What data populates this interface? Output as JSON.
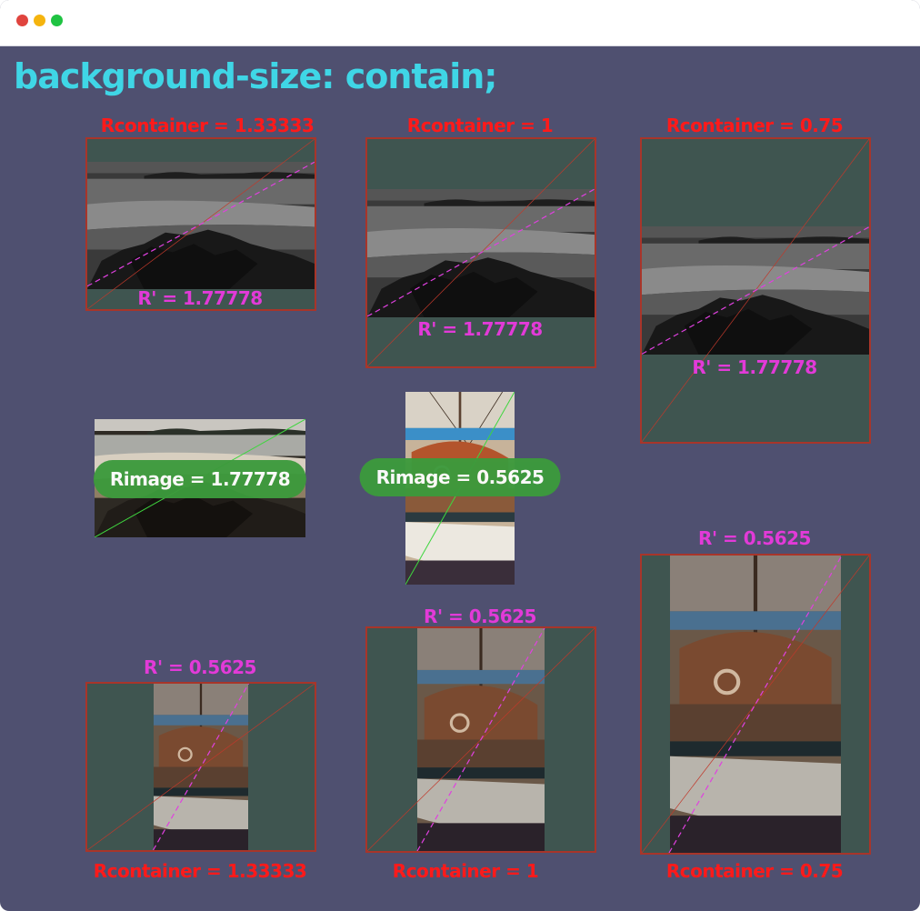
{
  "window": {
    "controls": [
      "close",
      "minimize",
      "maximize"
    ],
    "title": "background-size: contain;"
  },
  "labels": {
    "rcontainer_133": "Rcontainer = 1.33333",
    "rcontainer_1": "Rcontainer = 1",
    "rcontainer_075": "Rcontainer = 0.75",
    "r_prime_wide": "R' = 1.77778",
    "r_prime_tall": "R' = 0.5625",
    "rimage_wide": "Rimage = 1.77778",
    "rimage_tall": "Rimage = 0.5625"
  },
  "colors": {
    "window_bg": "#4f5070",
    "heading": "#3fd6e6",
    "container_fill": "#3f5550",
    "container_border": "#a8352a",
    "container_label": "#ff1a1a",
    "r_prime_label": "#e23ad8",
    "rimage_pill": "#3c9a3c",
    "container_diagonal": "#c0392b",
    "image_diagonal_contained": "#e040e0",
    "image_diagonal_source": "#3fd63f"
  },
  "images": {
    "landscape": {
      "description_icon": "beach-photo-icon"
    },
    "portrait": {
      "description_icon": "sailboat-photo-icon"
    }
  }
}
